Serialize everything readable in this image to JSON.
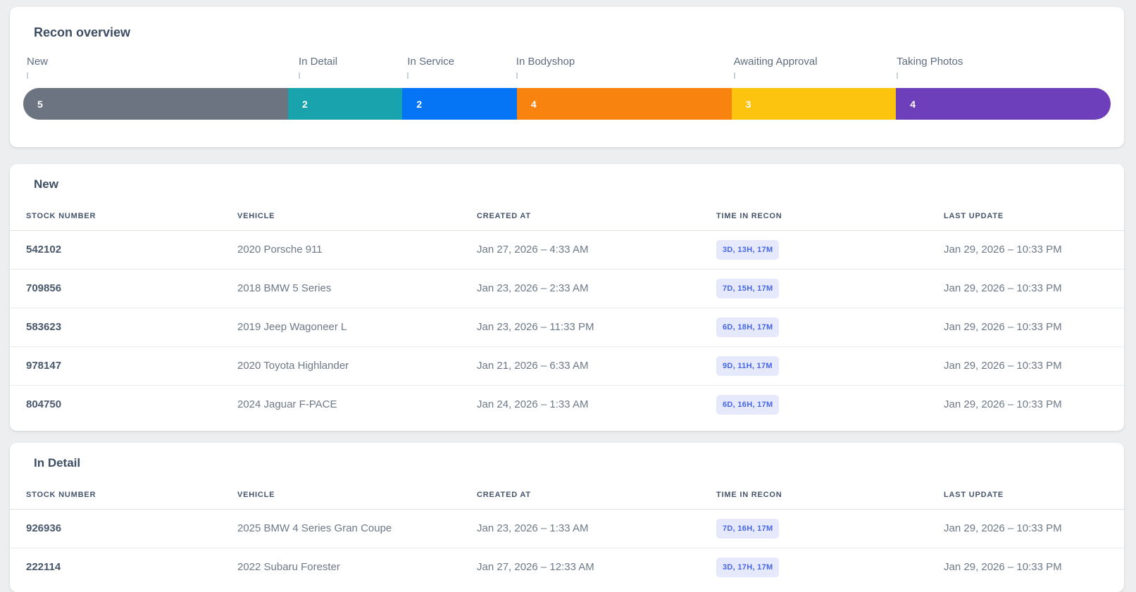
{
  "overview": {
    "title": "Recon overview",
    "stages": [
      {
        "label": "New",
        "count": 5,
        "color": "#6b7480"
      },
      {
        "label": "In Detail",
        "count": 2,
        "color": "#18a3ad"
      },
      {
        "label": "In Service",
        "count": 2,
        "color": "#0675f5"
      },
      {
        "label": "In Bodyshop",
        "count": 4,
        "color": "#f8830f"
      },
      {
        "label": "Awaiting Approval",
        "count": 3,
        "color": "#fcc30f"
      },
      {
        "label": "Taking Photos",
        "count": 4,
        "color": "#6e3fba"
      }
    ]
  },
  "columns": {
    "stock": "STOCK NUMBER",
    "vehicle": "VEHICLE",
    "created": "CREATED AT",
    "time": "TIME IN RECON",
    "updated": "LAST UPDATE"
  },
  "sections": [
    {
      "title": "New",
      "rows": [
        {
          "stock": "542102",
          "vehicle": "2020 Porsche 911",
          "created": "Jan 27, 2026 – 4:33 AM",
          "time": "3D, 13H, 17M",
          "updated": "Jan 29, 2026 – 10:33 PM"
        },
        {
          "stock": "709856",
          "vehicle": "2018 BMW 5 Series",
          "created": "Jan 23, 2026 – 2:33 AM",
          "time": "7D, 15H, 17M",
          "updated": "Jan 29, 2026 – 10:33 PM"
        },
        {
          "stock": "583623",
          "vehicle": "2019 Jeep Wagoneer L",
          "created": "Jan 23, 2026 – 11:33 PM",
          "time": "6D, 18H, 17M",
          "updated": "Jan 29, 2026 – 10:33 PM"
        },
        {
          "stock": "978147",
          "vehicle": "2020 Toyota Highlander",
          "created": "Jan 21, 2026 – 6:33 AM",
          "time": "9D, 11H, 17M",
          "updated": "Jan 29, 2026 – 10:33 PM"
        },
        {
          "stock": "804750",
          "vehicle": "2024 Jaguar F-PACE",
          "created": "Jan 24, 2026 – 1:33 AM",
          "time": "6D, 16H, 17M",
          "updated": "Jan 29, 2026 – 10:33 PM"
        }
      ]
    },
    {
      "title": "In Detail",
      "rows": [
        {
          "stock": "926936",
          "vehicle": "2025 BMW 4 Series Gran Coupe",
          "created": "Jan 23, 2026 – 1:33 AM",
          "time": "7D, 16H, 17M",
          "updated": "Jan 29, 2026 – 10:33 PM"
        },
        {
          "stock": "222114",
          "vehicle": "2022 Subaru Forester",
          "created": "Jan 27, 2026 – 12:33 AM",
          "time": "3D, 17H, 17M",
          "updated": "Jan 29, 2026 – 10:33 PM"
        }
      ]
    }
  ],
  "theme": {
    "badge_bg": "#e5e9fb",
    "badge_text": "#4565e6"
  }
}
